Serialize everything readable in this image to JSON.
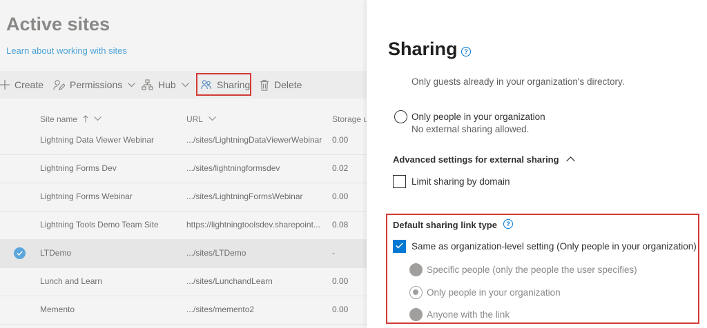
{
  "page": {
    "title": "Active sites",
    "learn_link": "Learn about working with sites"
  },
  "toolbar": {
    "create": "Create",
    "permissions": "Permissions",
    "hub": "Hub",
    "sharing": "Sharing",
    "delete": "Delete"
  },
  "table": {
    "columns": {
      "site_name": "Site name",
      "url": "URL",
      "storage": "Storage u"
    },
    "rows": [
      {
        "name": "Lightning Data Viewer Webinar",
        "url": ".../sites/LightningDataViewerWebinar",
        "storage": "0.00"
      },
      {
        "name": "Lightning Forms Dev",
        "url": ".../sites/lightningformsdev",
        "storage": "0.02"
      },
      {
        "name": "Lightning Forms Webinar",
        "url": ".../sites/LightningFormsWebinar",
        "storage": "0.00"
      },
      {
        "name": "Lightning Tools Demo Team Site",
        "url": "https://lightningtoolsdev.sharepoint...",
        "storage": "0.08"
      },
      {
        "name": "LTDemo",
        "url": ".../sites/LTDemo",
        "storage": "-"
      },
      {
        "name": "Lunch and Learn",
        "url": ".../sites/LunchandLearn",
        "storage": "0.00"
      },
      {
        "name": "Memento",
        "url": ".../sites/memento2",
        "storage": "0.00"
      }
    ]
  },
  "panel": {
    "title": "Sharing",
    "cut_off_text": "Only guests already in your organization's directory.",
    "only_org_label": "Only people in your organization",
    "only_org_desc": "No external sharing allowed.",
    "advanced_label": "Advanced settings for external sharing",
    "limit_domain_label": "Limit sharing by domain",
    "default_link_heading": "Default sharing link type",
    "same_as_org_label": "Same as organization-level setting (Only people in your organization)",
    "opt_specific": "Specific people (only the people the user specifies)",
    "opt_org": "Only people in your organization",
    "opt_anyone": "Anyone with the link"
  }
}
